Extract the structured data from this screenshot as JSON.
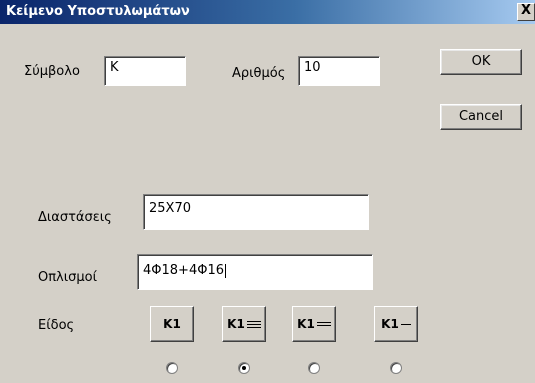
{
  "window": {
    "title": "Κείμενο Υποστυλωμάτων",
    "close_label": "X"
  },
  "fields": {
    "symbol": {
      "label": "Σύμβολο",
      "value": "K"
    },
    "number": {
      "label": "Αριθμός",
      "value": "10"
    },
    "dimensions": {
      "label": "Διαστάσεις",
      "value": "25X70"
    },
    "reinforcement": {
      "label": "Οπλισμοί",
      "value": "4Φ18+4Φ16"
    }
  },
  "buttons": {
    "ok": "OK",
    "cancel": "Cancel"
  },
  "type": {
    "label": "Είδος",
    "options": [
      {
        "text": "K1",
        "icon": "k1-plain-icon",
        "selected": false
      },
      {
        "text": "K1",
        "icon": "k1-double-underline-icon",
        "selected": true
      },
      {
        "text": "K1",
        "icon": "k1-single-underline-icon",
        "selected": false
      },
      {
        "text": "K1",
        "icon": "k1-inline-small-icon",
        "selected": false
      }
    ]
  }
}
